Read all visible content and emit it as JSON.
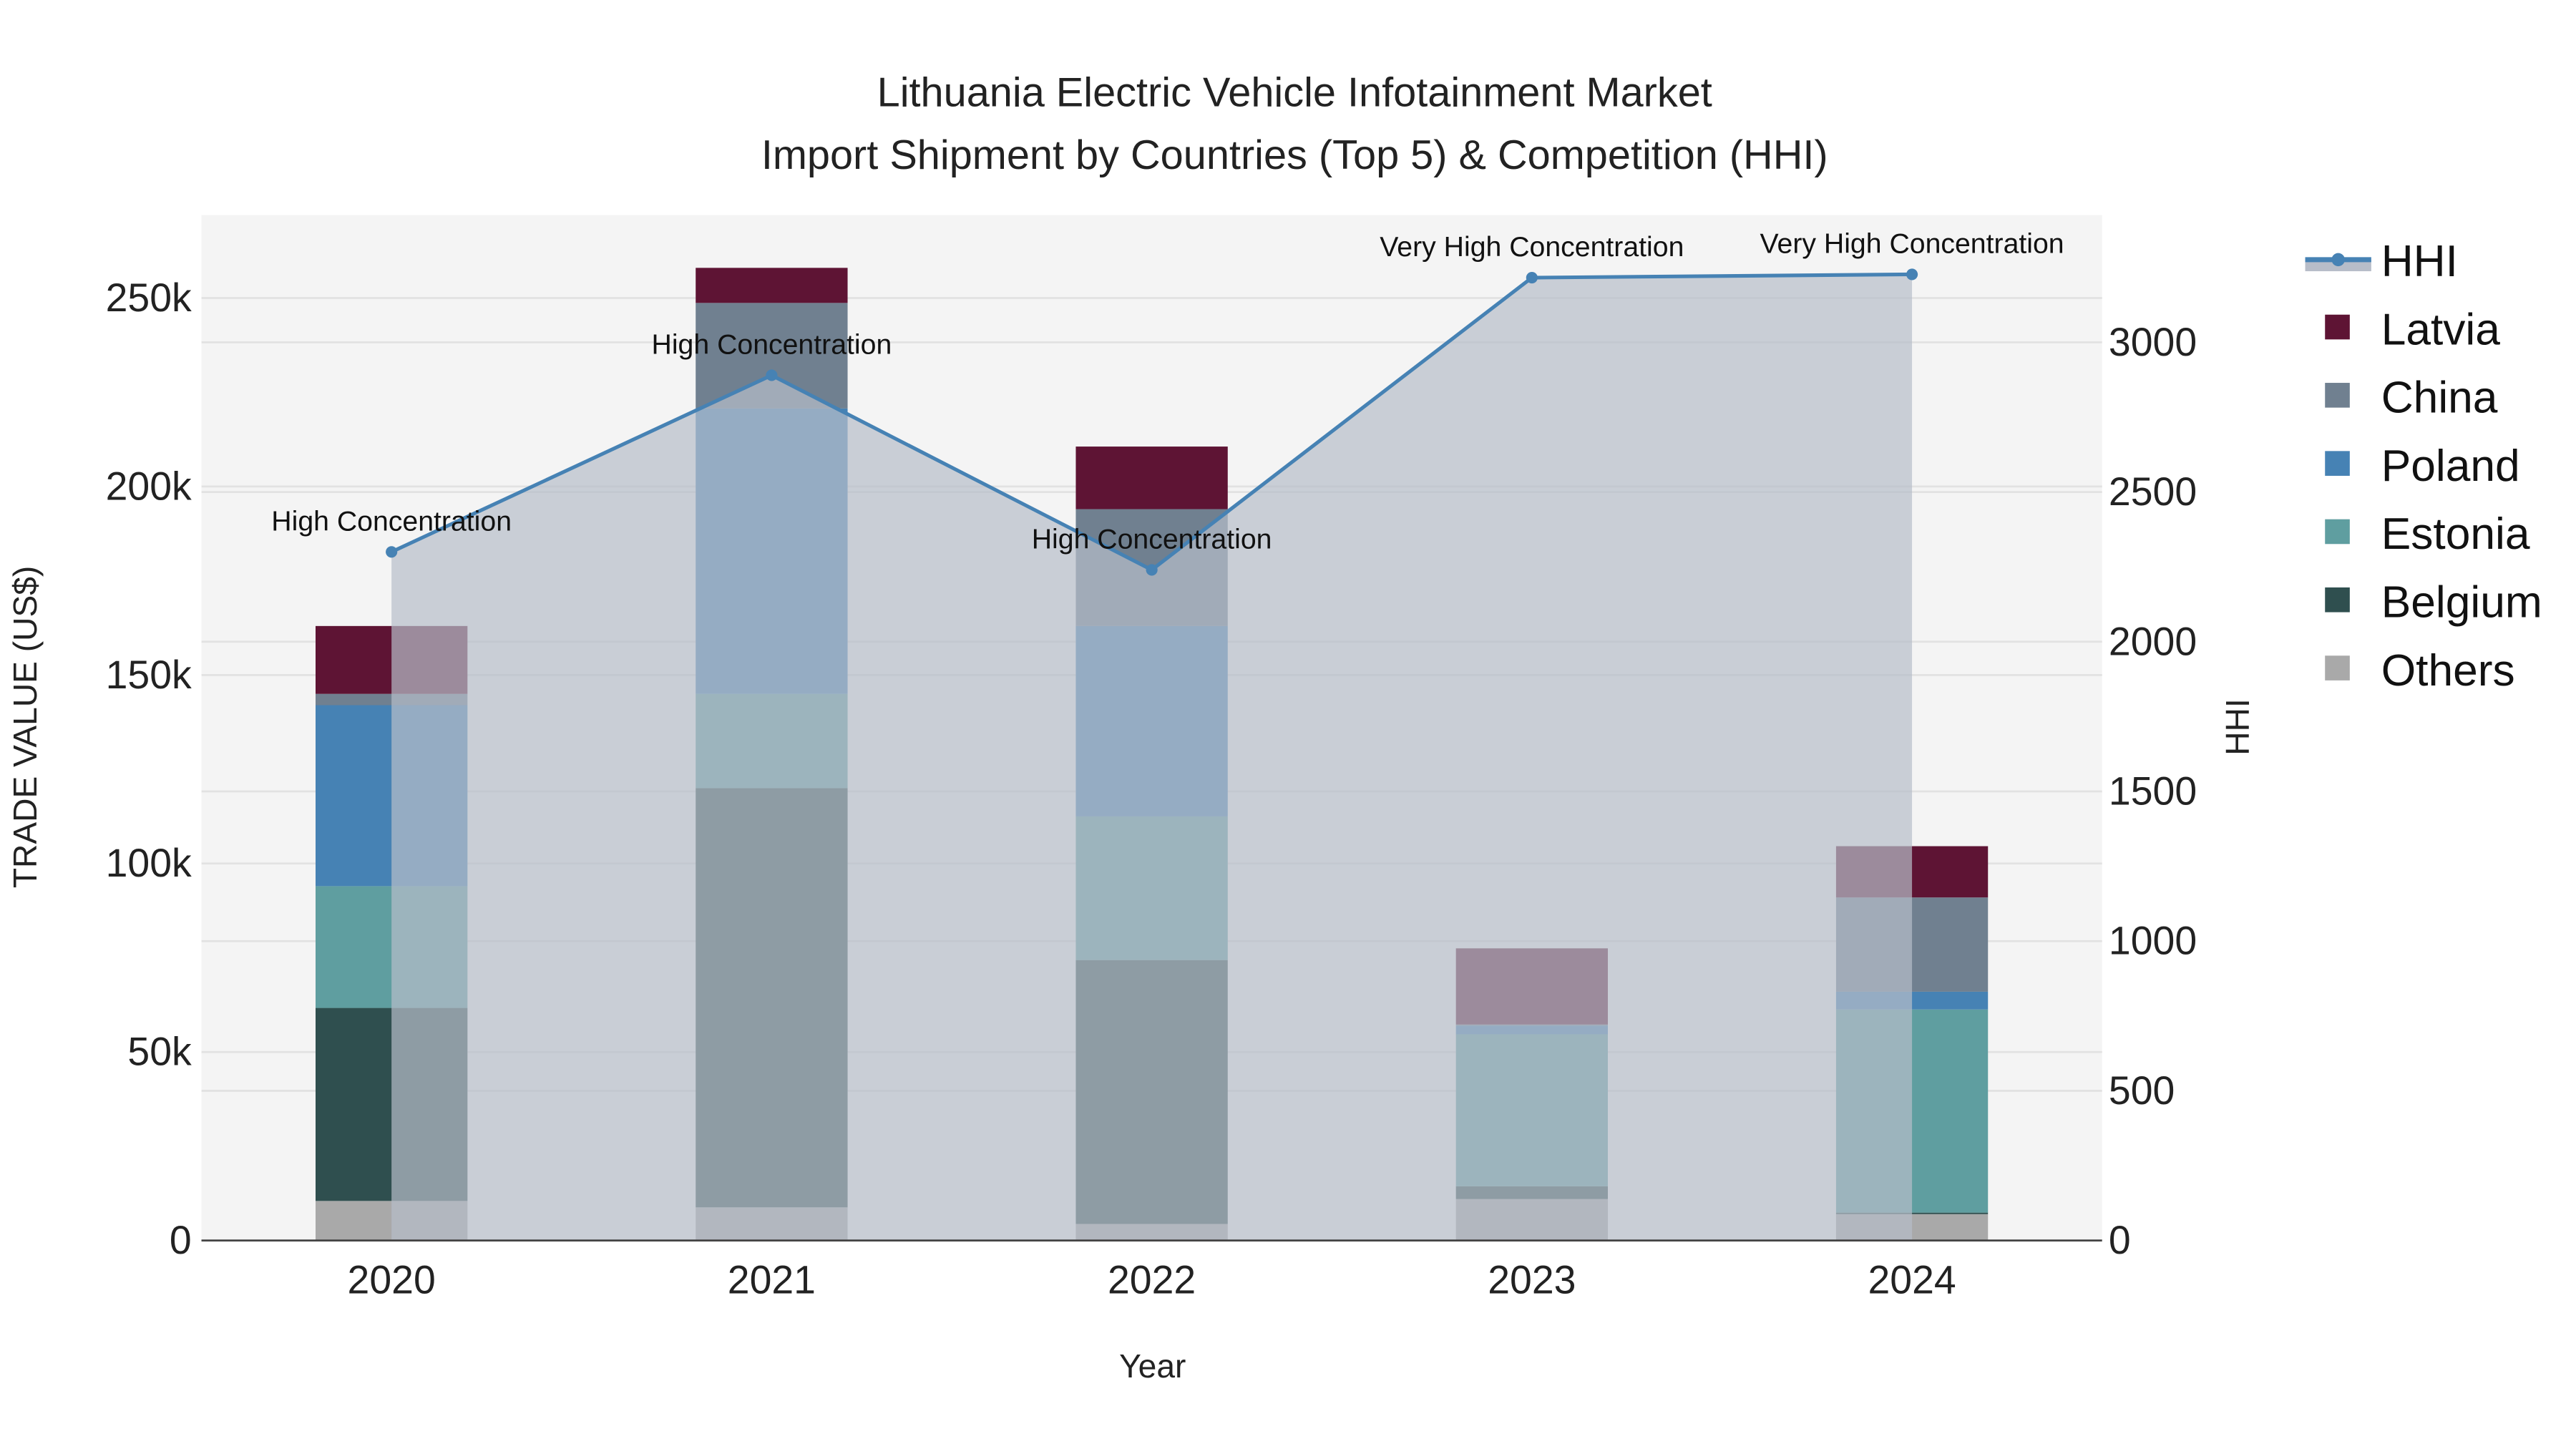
{
  "chart_data": {
    "type": "bar",
    "title_line1": "Lithuania Electric Vehicle Infotainment Market",
    "title_line2": "Import Shipment by Countries (Top 5) & Competition (HHI)",
    "xlabel": "Year",
    "ylabel": "TRADE VALUE (US$)",
    "y2label": "HHI",
    "categories": [
      "2020",
      "2021",
      "2022",
      "2023",
      "2024"
    ],
    "ylim": [
      0,
      272000
    ],
    "y2lim": [
      0,
      3425
    ],
    "yticks": [
      {
        "v": 0,
        "label": "0"
      },
      {
        "v": 50000,
        "label": "50k"
      },
      {
        "v": 100000,
        "label": "100k"
      },
      {
        "v": 150000,
        "label": "150k"
      },
      {
        "v": 200000,
        "label": "200k"
      },
      {
        "v": 250000,
        "label": "250k"
      }
    ],
    "y2ticks": [
      {
        "v": 0,
        "label": "0"
      },
      {
        "v": 500,
        "label": "500"
      },
      {
        "v": 1000,
        "label": "1000"
      },
      {
        "v": 1500,
        "label": "1500"
      },
      {
        "v": 2000,
        "label": "2000"
      },
      {
        "v": 2500,
        "label": "2500"
      },
      {
        "v": 3000,
        "label": "3000"
      }
    ],
    "grid": true,
    "barmode": "stack",
    "legend_position": "right",
    "series": [
      {
        "name": "Others",
        "color": "#a9a9a9",
        "values": [
          10500,
          8800,
          4400,
          11000,
          7000
        ]
      },
      {
        "name": "Belgium",
        "color": "#2f4f4f",
        "values": [
          51200,
          111200,
          70000,
          3400,
          400
        ]
      },
      {
        "name": "Estonia",
        "color": "#5f9ea0",
        "values": [
          32300,
          25000,
          38100,
          40300,
          53900
        ]
      },
      {
        "name": "Poland",
        "color": "#4682b4",
        "values": [
          48000,
          75700,
          50500,
          2300,
          4700
        ]
      },
      {
        "name": "China",
        "color": "#708090",
        "values": [
          3000,
          28000,
          31000,
          300,
          25000
        ]
      },
      {
        "name": "Latvia",
        "color": "#5e1434",
        "values": [
          18000,
          9300,
          16600,
          20200,
          13600
        ]
      }
    ],
    "hhi": {
      "name": "HHI",
      "color": "#4682b4",
      "fill": "#b7bdc9",
      "values": [
        2300,
        2890,
        2240,
        3216,
        3227
      ],
      "annotations": [
        "High Concentration",
        "High Concentration",
        "High Concentration",
        "Very High Concentration",
        "Very High Concentration"
      ]
    },
    "legend": [
      "HHI",
      "Latvia",
      "China",
      "Poland",
      "Estonia",
      "Belgium",
      "Others"
    ]
  }
}
